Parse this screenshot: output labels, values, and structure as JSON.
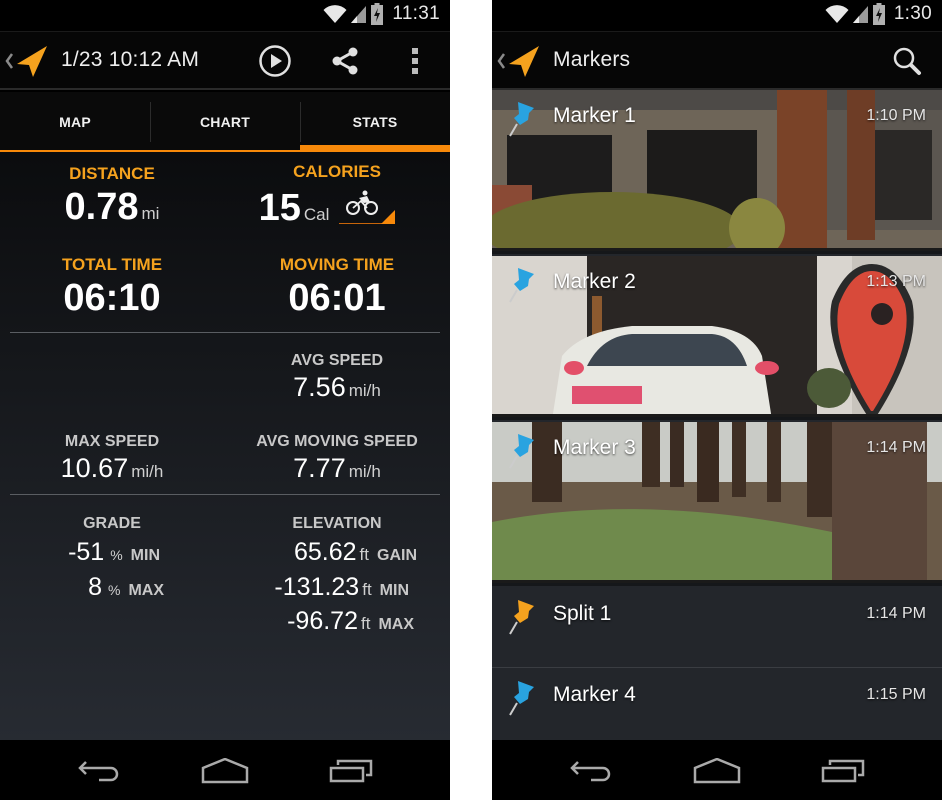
{
  "left_screen": {
    "status_bar": {
      "time": "11:31",
      "icons": [
        "wifi-icon",
        "signal-icon",
        "battery-charging-icon"
      ]
    },
    "action_bar": {
      "title": "1/23 10:12 AM",
      "actions": [
        "play-icon",
        "share-icon",
        "overflow-menu-icon"
      ]
    },
    "tabs": [
      {
        "label": "MAP",
        "active": false
      },
      {
        "label": "CHART",
        "active": false
      },
      {
        "label": "STATS",
        "active": true
      }
    ],
    "stats": {
      "distance": {
        "label": "DISTANCE",
        "value": "0.78",
        "unit": "mi"
      },
      "calories": {
        "label": "CALORIES",
        "value": "15",
        "unit": "Cal",
        "activity_icon": "bicycle-icon"
      },
      "total_time": {
        "label": "TOTAL TIME",
        "value": "06:10"
      },
      "moving_time": {
        "label": "MOVING TIME",
        "value": "06:01"
      },
      "avg_speed": {
        "label": "AVG SPEED",
        "value": "7.56",
        "unit": "mi/h"
      },
      "max_speed": {
        "label": "MAX SPEED",
        "value": "10.67",
        "unit": "mi/h"
      },
      "avg_moving_speed": {
        "label": "AVG MOVING SPEED",
        "value": "7.77",
        "unit": "mi/h"
      },
      "grade": {
        "label": "GRADE",
        "rows": [
          {
            "value": "-51",
            "unit": "%",
            "tag": "MIN"
          },
          {
            "value": "8",
            "unit": "%",
            "tag": "MAX"
          }
        ]
      },
      "elevation": {
        "label": "ELEVATION",
        "rows": [
          {
            "value": "65.62",
            "unit": "ft",
            "tag": "GAIN"
          },
          {
            "value": "-131.23",
            "unit": "ft",
            "tag": "MIN"
          },
          {
            "value": "-96.72",
            "unit": "ft",
            "tag": "MAX"
          }
        ]
      }
    },
    "nav_bar": [
      "back-icon",
      "home-icon",
      "recents-icon"
    ]
  },
  "right_screen": {
    "status_bar": {
      "time": "1:30",
      "icons": [
        "wifi-icon",
        "signal-icon",
        "battery-charging-icon"
      ]
    },
    "action_bar": {
      "title": "Markers",
      "actions": [
        "search-icon"
      ]
    },
    "markers": [
      {
        "name": "Marker 1",
        "time": "1:10 PM",
        "pin_color": "#29a3e0",
        "photo": "building-with-redwoods"
      },
      {
        "name": "Marker 2",
        "time": "1:13 PM",
        "pin_color": "#29a3e0",
        "photo": "street-view-car-and-map-pin"
      },
      {
        "name": "Marker 3",
        "time": "1:14 PM",
        "pin_color": "#29a3e0",
        "photo": "redwood-grove-lawn"
      },
      {
        "name": "Split 1",
        "time": "1:14 PM",
        "pin_color": "#f5a21e",
        "photo": null
      },
      {
        "name": "Marker 4",
        "time": "1:15 PM",
        "pin_color": "#29a3e0",
        "photo": null
      }
    ],
    "nav_bar": [
      "back-icon",
      "home-icon",
      "recents-icon"
    ]
  },
  "colors": {
    "accent": "#f7890a",
    "label_orange": "#f5a21e",
    "pin_blue": "#29a3e0"
  }
}
